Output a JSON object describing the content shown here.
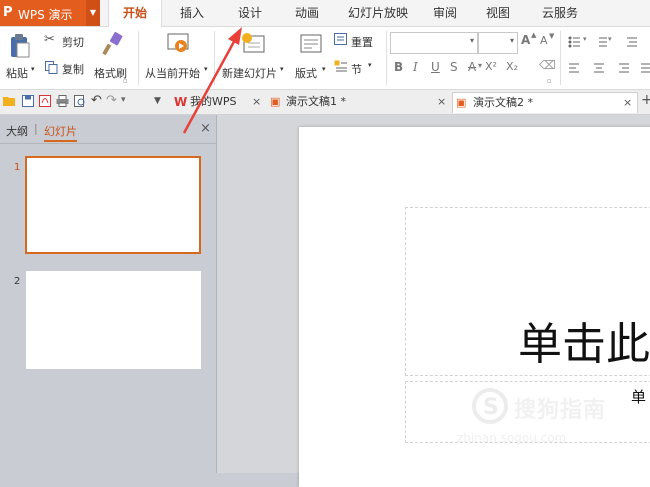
{
  "app": {
    "logo": "P",
    "name": "WPS 演示"
  },
  "menu": [
    "开始",
    "插入",
    "设计",
    "动画",
    "幻灯片放映",
    "审阅",
    "视图",
    "云服务"
  ],
  "ribbon": {
    "paste": "粘贴",
    "cut": "剪切",
    "copy": "复制",
    "format_painter": "格式刷",
    "from_current": "从当前开始",
    "new_slide": "新建幻灯片",
    "layout": "版式",
    "reset": "重置",
    "section": "节",
    "font_grow": "A",
    "font_shrink": "A",
    "bold": "B",
    "italic": "I",
    "underline": "U",
    "shadow": "S",
    "strike": "A",
    "superscript": "X²",
    "subscript": "X₂"
  },
  "tabs": {
    "mywps": "我的WPS",
    "doc1": "演示文稿1 *",
    "doc2": "演示文稿2 *",
    "close": "×",
    "add": "+"
  },
  "leftpanel": {
    "outline_tab": "大纲",
    "divider": "|",
    "slides_tab": "幻灯片",
    "close": "×",
    "slides": [
      {
        "number": "1"
      },
      {
        "number": "2"
      }
    ]
  },
  "slide": {
    "title_placeholder": "单击此",
    "subtitle_placeholder": "单"
  },
  "watermark": {
    "text": "搜狗指南",
    "url": "zhinan.sogou.com"
  },
  "colors": {
    "accent": "#e35d1f",
    "arrow": "#e8413a",
    "selection": "#d4691f"
  }
}
